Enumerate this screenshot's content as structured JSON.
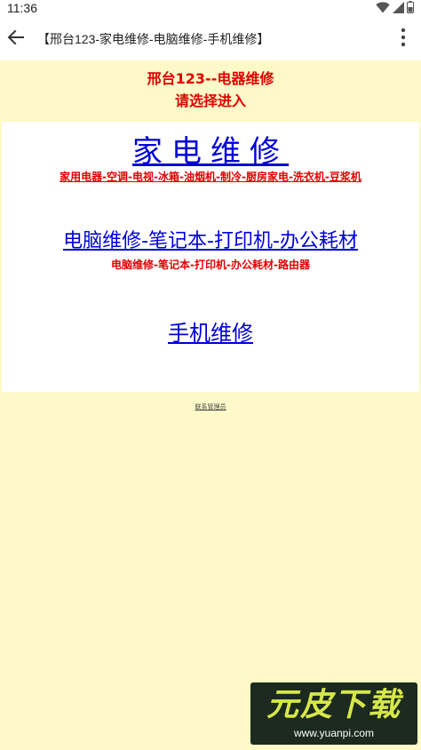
{
  "status_bar": {
    "time": "11:36",
    "icons": [
      "wifi-icon",
      "signal-icon",
      "battery-icon"
    ]
  },
  "app_bar": {
    "back_icon": "arrow-left-icon",
    "title": "【邢台123-家电维修-电脑维修-手机维修】",
    "more_icon": "more-vertical-icon"
  },
  "header": {
    "line1": "邢台123--电器维修",
    "line2": "请选择进入"
  },
  "links": {
    "appliance": {
      "label": "家电维修",
      "subtitle": "家用电器-空调-电视-冰箱-油烟机-制冷-厨房家电-洗衣机-豆浆机"
    },
    "computer": {
      "label": "电脑维修-笔记本-打印机-办公耗材",
      "subtitle": "电脑维修-笔记本-打印机-办公耗材-路由器"
    },
    "phone": {
      "label": "手机维修"
    }
  },
  "footer": {
    "contact": "联系管理员"
  },
  "watermark": {
    "logo": "元皮下载",
    "url": "www.yuanpi.com"
  },
  "colors": {
    "page_background": "#fdf9c8",
    "link_blue": "#0000d8",
    "accent_red": "#e00000"
  }
}
